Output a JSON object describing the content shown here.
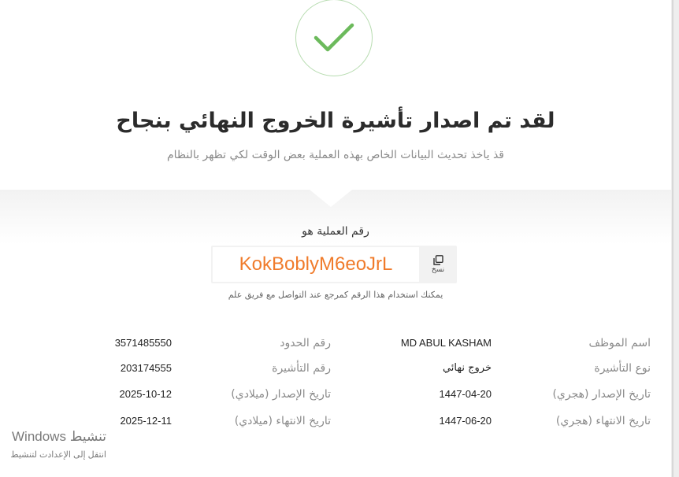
{
  "success": {
    "title": "لقد تم اصدار تأشيرة الخروج النهائي بنجاح",
    "subtitle": "قذ ياخذ تحديث البيانات الخاص بهذه العملية بعض الوقت لكي تظهر بالنظام"
  },
  "reference": {
    "label": "رقم العملية هو",
    "code": "KokBoblyM6eoJrL",
    "copy_label": "نسخ",
    "hint": "يمكنك استخدام هذا الرقم كمرجع عند التواصل مع فريق علم"
  },
  "details": {
    "employee_name_label": "اسم الموظف",
    "employee_name": "MD ABUL KASHAM",
    "border_number_label": "رقم الحدود",
    "border_number": "3571485550",
    "visa_type_label": "نوع التأشيرة",
    "visa_type": "خروج نهائي",
    "visa_number_label": "رقم التأشيرة",
    "visa_number": "203174555",
    "issue_hijri_label": "تاريخ الإصدار (هجري)",
    "issue_hijri": "1447-04-20",
    "issue_greg_label": "تاريخ الإصدار (ميلادي)",
    "issue_greg": "2025-10-12",
    "expiry_hijri_label": "تاريخ الانتهاء (هجري)",
    "expiry_hijri": "1447-06-20",
    "expiry_greg_label": "تاريخ الانتهاء (ميلادي)",
    "expiry_greg": "2025-12-11"
  },
  "watermark": {
    "line1": "تنشيط Windows",
    "line2": "انتقل إلى الإعدادت لتنشيط"
  },
  "colors": {
    "check": "#6cba5c",
    "ref_code": "#f07b2b"
  }
}
